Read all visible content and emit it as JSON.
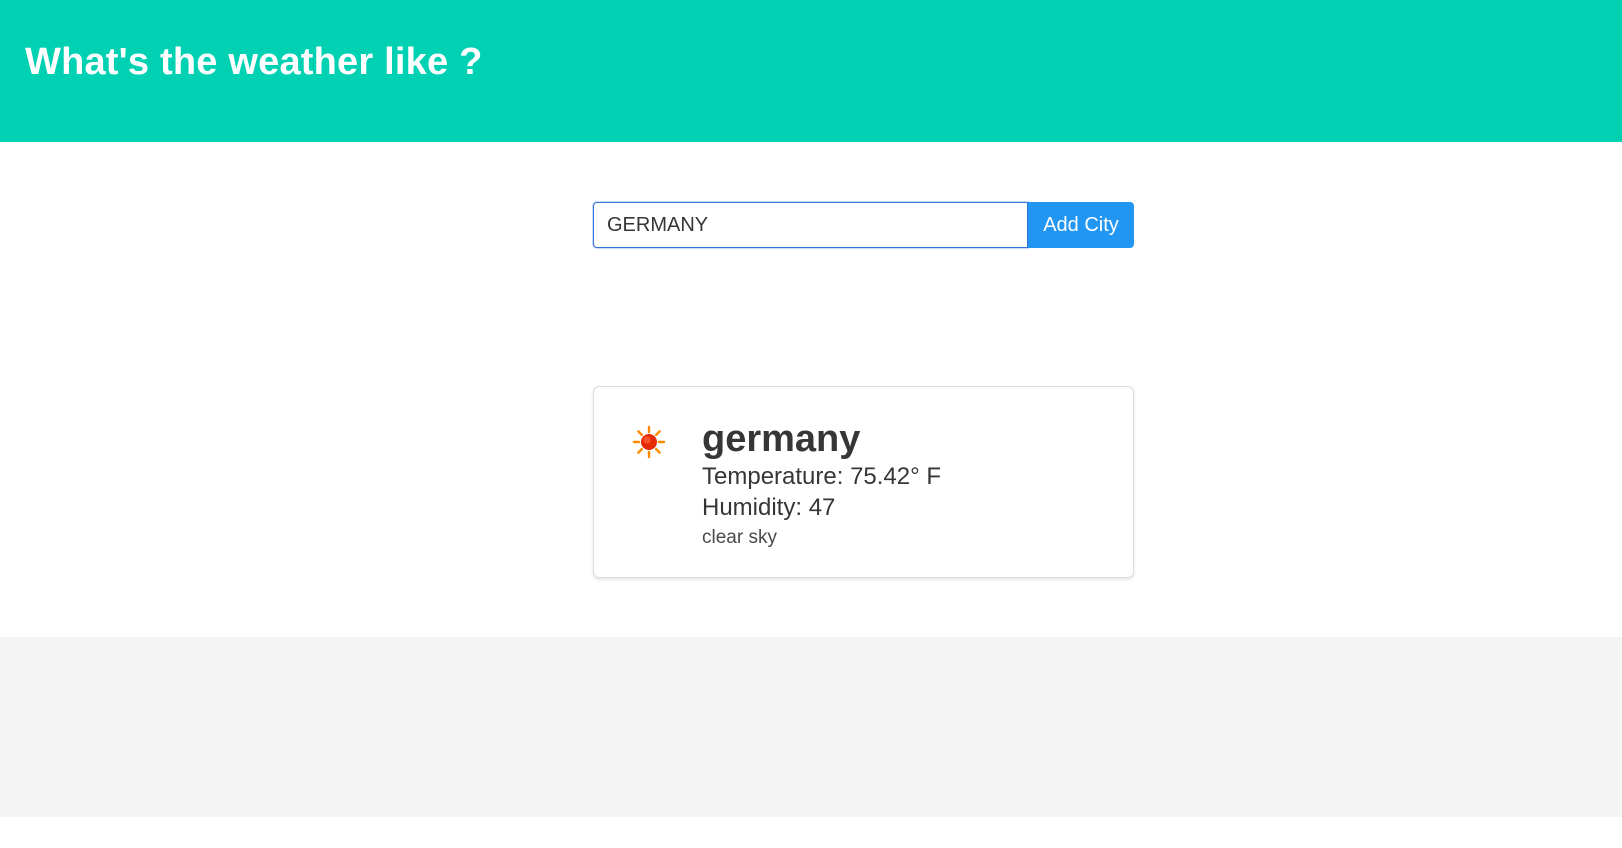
{
  "header": {
    "title": "What's the weather like ?"
  },
  "search": {
    "value": "GERMANY",
    "button_label": "Add City"
  },
  "weather_card": {
    "icon": "sun-icon",
    "city": "germany",
    "temperature": "Temperature: 75.42° F",
    "humidity": "Humidity: 47",
    "description": "clear sky"
  },
  "colors": {
    "header_bg": "#00d1b2",
    "button_bg": "#2196f3",
    "footer_bg": "#f4f4f4"
  }
}
